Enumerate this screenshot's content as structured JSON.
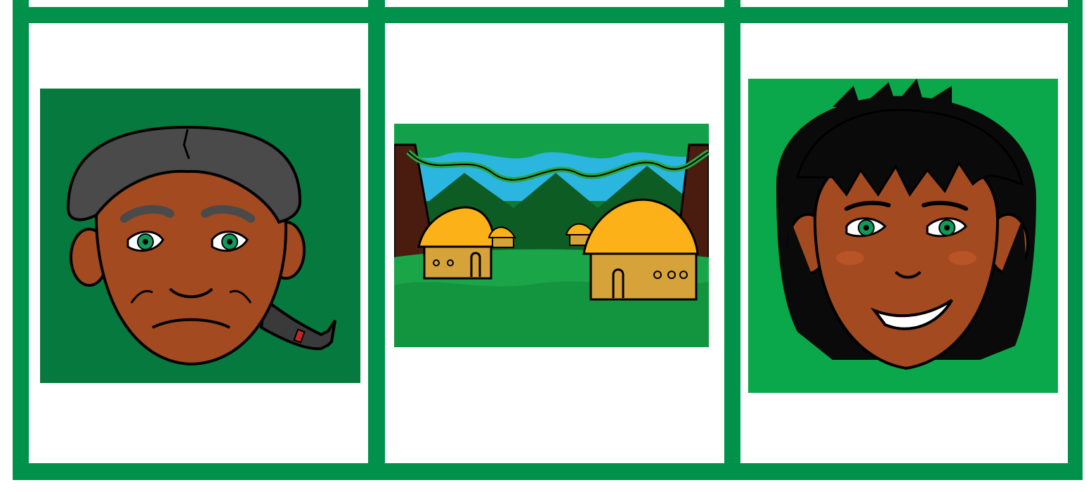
{
  "board": {
    "frame_color": "#00914a",
    "cells": [
      {
        "name": "elder",
        "background": "#067a3e",
        "subject": "old-man-face-icon"
      },
      {
        "name": "village",
        "background": "#1aa548",
        "subject": "village-huts-icon"
      },
      {
        "name": "boy",
        "background": "#0aa84a",
        "subject": "young-boy-face-icon"
      }
    ]
  }
}
